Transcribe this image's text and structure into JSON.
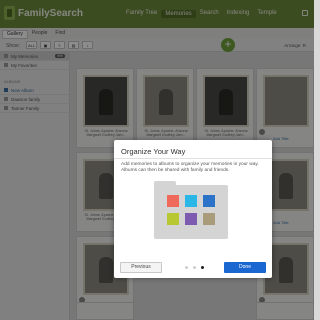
{
  "header": {
    "brand": "FamilySearch",
    "nav": [
      "Family Tree",
      "Memories",
      "Search",
      "Indexing",
      "Temple"
    ],
    "active_nav": "Memories"
  },
  "subnav": {
    "items": [
      "Gallery",
      "People",
      "Find"
    ],
    "active": "Gallery"
  },
  "toolbar": {
    "show_label": "Show:",
    "all_label": "ALL",
    "add_symbol": "+",
    "arrange_label": "Arrange: R"
  },
  "sidebar": {
    "my_memories": "My Memories",
    "my_memories_count": "999",
    "my_favorites": "My Favorites",
    "albums_heading": "ALBUMS",
    "new_album": "New Album",
    "albums": [
      "Dawson family",
      "Tanner Family"
    ]
  },
  "gallery": {
    "caption_a": "St. Johns, Apache, Arizona Margaret Godfrey Jam...",
    "caption_b": "St. Johns, Apache, Arizona Margaret Godfrey Jam...",
    "caption_c": "St. Johns, Apache, Arizona Margaret Godfrey Jam...",
    "caption_d": "St. Johns, Apache, Arizona Margaret Godfrey Jam...",
    "caption_e": "St. Johns, Apache, Arizona Margaret Godfrey Jam...",
    "tag_label": "Add Title"
  },
  "modal": {
    "title": "Organize Your Way",
    "body": "Add memories to albums to organize your memories in your way. Albums can then be shared with family and friends.",
    "previous_label": "Previous",
    "done_label": "Done",
    "page_index": 3,
    "page_count": 3,
    "tile_colors": [
      "#ef6a5a",
      "#2bb6e8",
      "#2a73c9",
      "#b8c832",
      "#7c5bb0",
      "#a89c7a"
    ]
  }
}
